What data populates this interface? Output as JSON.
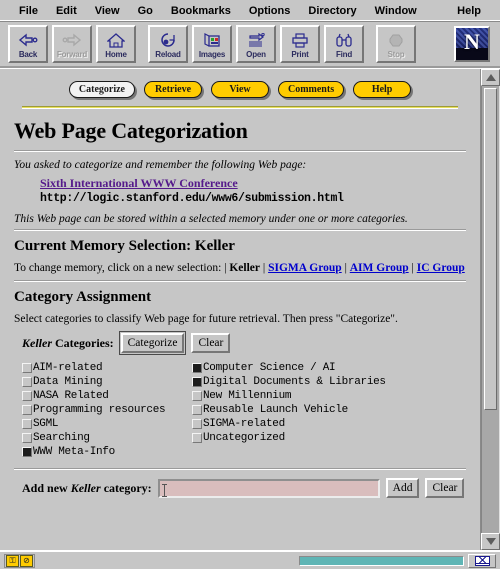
{
  "browser": {
    "menu": [
      "File",
      "Edit",
      "View",
      "Go",
      "Bookmarks",
      "Options",
      "Directory",
      "Window"
    ],
    "menu_help": "Help",
    "toolbar": [
      {
        "label": "Back",
        "icon": "back-arrow-icon",
        "disabled": false
      },
      {
        "label": "Forward",
        "icon": "forward-arrow-icon",
        "disabled": true
      },
      {
        "label": "Home",
        "icon": "house-icon",
        "disabled": false
      },
      {
        "label": "Reload",
        "icon": "reload-icon",
        "disabled": false
      },
      {
        "label": "Images",
        "icon": "images-icon",
        "disabled": false
      },
      {
        "label": "Open",
        "icon": "open-icon",
        "disabled": false
      },
      {
        "label": "Print",
        "icon": "printer-icon",
        "disabled": false
      },
      {
        "label": "Find",
        "icon": "binoculars-icon",
        "disabled": false
      },
      {
        "label": "Stop",
        "icon": "stop-sign-icon",
        "disabled": true
      }
    ],
    "logo_letter": "N"
  },
  "nav_tabs": [
    {
      "label": "Categorize",
      "active": true
    },
    {
      "label": "Retrieve",
      "active": false
    },
    {
      "label": "View",
      "active": false
    },
    {
      "label": "Comments",
      "active": false
    },
    {
      "label": "Help",
      "active": false
    }
  ],
  "page": {
    "title": "Web Page Categorization",
    "lead": "You asked to categorize and remember the following Web page:",
    "page_link_text": "Sixth International WWW Conference",
    "page_url": "http://logic.stanford.edu/www6/submission.html",
    "note": "This Web page can be stored within a selected memory under one or more categories.",
    "memory_heading": "Current Memory Selection: Keller",
    "memory_change_text": "To change memory, click on a new selection:",
    "memory_sep": "|",
    "memories": [
      {
        "label": "Keller",
        "current": true
      },
      {
        "label": "SIGMA Group",
        "current": false
      },
      {
        "label": "AIM Group",
        "current": false
      },
      {
        "label": "IC Group",
        "current": false
      }
    ],
    "assignment_heading": "Category Assignment",
    "assignment_text": "Select categories to classify Web page for future retrieval. Then press \"Categorize\".",
    "categories_label_name": "Keller",
    "categories_label_rest": "Categories:",
    "categorize_button": "Categorize",
    "clear_button": "Clear",
    "categories": [
      {
        "label": "AIM-related",
        "checked": false
      },
      {
        "label": "Computer Science / AI",
        "checked": true
      },
      {
        "label": "Data Mining",
        "checked": false
      },
      {
        "label": "Digital Documents & Libraries",
        "checked": true
      },
      {
        "label": "NASA Related",
        "checked": false
      },
      {
        "label": "New Millennium",
        "checked": false
      },
      {
        "label": "Programming resources",
        "checked": false
      },
      {
        "label": "Reusable Launch Vehicle",
        "checked": false
      },
      {
        "label": "SGML",
        "checked": false
      },
      {
        "label": "SIGMA-related",
        "checked": false
      },
      {
        "label": "Searching",
        "checked": false
      },
      {
        "label": "Uncategorized",
        "checked": false
      },
      {
        "label": "WWW Meta-Info",
        "checked": true
      }
    ],
    "add_label_pre": "Add new",
    "add_label_name": "Keller",
    "add_label_post": "category:",
    "add_input_value": "",
    "add_input_placeholder": "",
    "add_button": "Add",
    "add_clear_button": "Clear"
  },
  "status": {
    "progress_percent": 100,
    "progress_color": "#5fb5b5"
  },
  "colors": {
    "face": "#c6c6c6",
    "pill_yellow": "#ffcc00",
    "pill_active": "#f2f2f2",
    "visited_link": "#551a8b",
    "link": "#0000cc",
    "field_pink": "#d9bdbd",
    "rule_yellow": "#e8e05a"
  }
}
